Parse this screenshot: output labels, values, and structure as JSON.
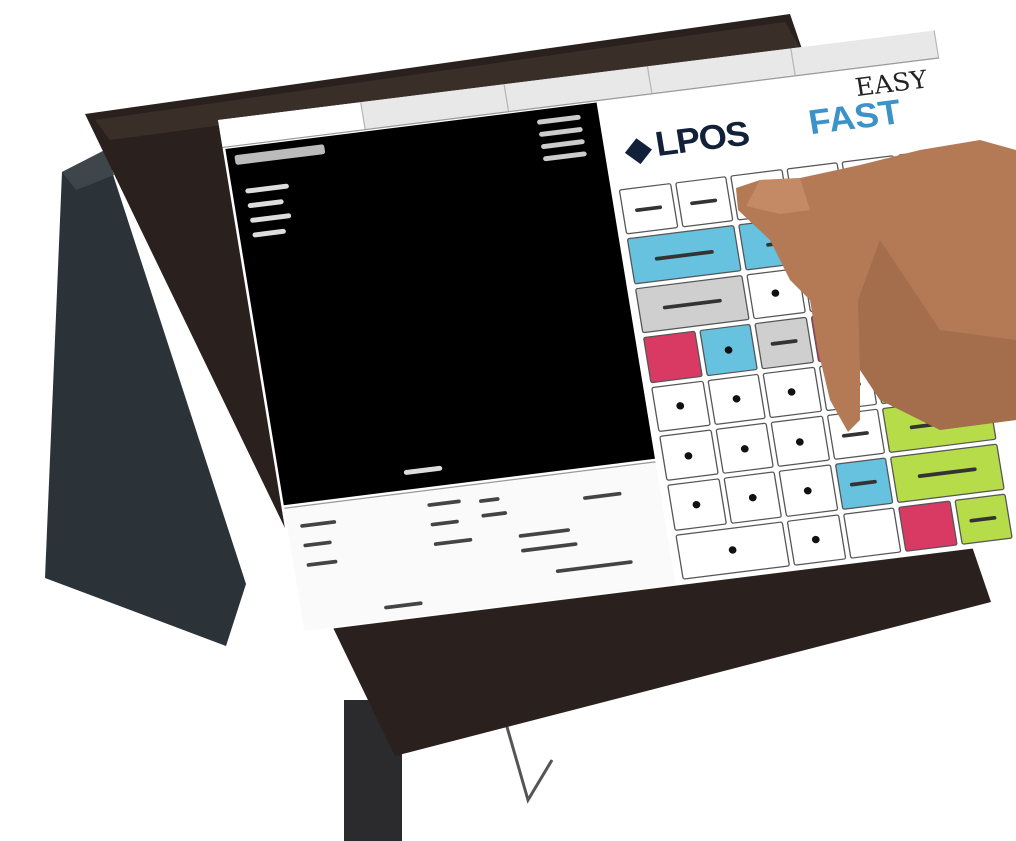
{
  "logo": {
    "mark": "◆",
    "brand": "LPOS",
    "fast": "FAST",
    "easy": "EASY"
  },
  "colors": {
    "bezel": "#2a211e",
    "stand": "#2b2a2c",
    "accent_blue": "#66c2de",
    "accent_red": "#d83a64",
    "accent_green": "#b7dc4a",
    "logo_blue": "#3b93c7"
  }
}
